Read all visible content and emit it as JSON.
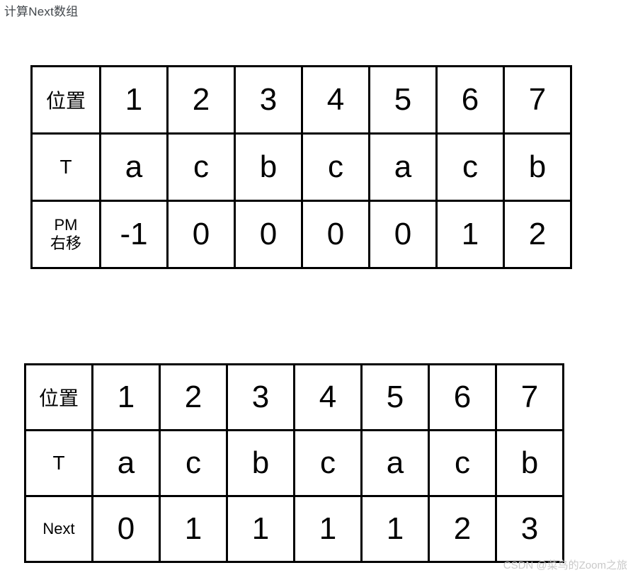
{
  "heading": ". 计算Next数组",
  "watermark": "CSDN @菜鸟的Zoom之旅",
  "tables": [
    {
      "id": "pm-shift-table",
      "rows": [
        {
          "label": "位置",
          "label_line2": "",
          "values": [
            "1",
            "2",
            "3",
            "4",
            "5",
            "6",
            "7"
          ]
        },
        {
          "label": "T",
          "label_line2": "",
          "values": [
            "a",
            "c",
            "b",
            "c",
            "a",
            "c",
            "b"
          ]
        },
        {
          "label": "PM",
          "label_line2": "右移",
          "values": [
            "-1",
            "0",
            "0",
            "0",
            "0",
            "1",
            "2"
          ]
        }
      ]
    },
    {
      "id": "next-table",
      "rows": [
        {
          "label": "位置",
          "label_line2": "",
          "values": [
            "1",
            "2",
            "3",
            "4",
            "5",
            "6",
            "7"
          ]
        },
        {
          "label": "T",
          "label_line2": "",
          "values": [
            "a",
            "c",
            "b",
            "c",
            "a",
            "c",
            "b"
          ]
        },
        {
          "label": "Next",
          "label_line2": "",
          "values": [
            "0",
            "1",
            "1",
            "1",
            "1",
            "2",
            "3"
          ]
        }
      ]
    }
  ],
  "chart_data": {
    "type": "table",
    "title": ". 计算Next数组",
    "tables": [
      {
        "name": "PM right-shift table",
        "row_headers": [
          "位置",
          "T",
          "PM 右移"
        ],
        "columns": [
          "1",
          "2",
          "3",
          "4",
          "5",
          "6",
          "7"
        ],
        "rows": [
          [
            "1",
            "2",
            "3",
            "4",
            "5",
            "6",
            "7"
          ],
          [
            "a",
            "c",
            "b",
            "c",
            "a",
            "c",
            "b"
          ],
          [
            "-1",
            "0",
            "0",
            "0",
            "0",
            "1",
            "2"
          ]
        ]
      },
      {
        "name": "Next array table",
        "row_headers": [
          "位置",
          "T",
          "Next"
        ],
        "columns": [
          "1",
          "2",
          "3",
          "4",
          "5",
          "6",
          "7"
        ],
        "rows": [
          [
            "1",
            "2",
            "3",
            "4",
            "5",
            "6",
            "7"
          ],
          [
            "a",
            "c",
            "b",
            "c",
            "a",
            "c",
            "b"
          ],
          [
            "0",
            "1",
            "1",
            "1",
            "1",
            "2",
            "3"
          ]
        ]
      }
    ]
  }
}
